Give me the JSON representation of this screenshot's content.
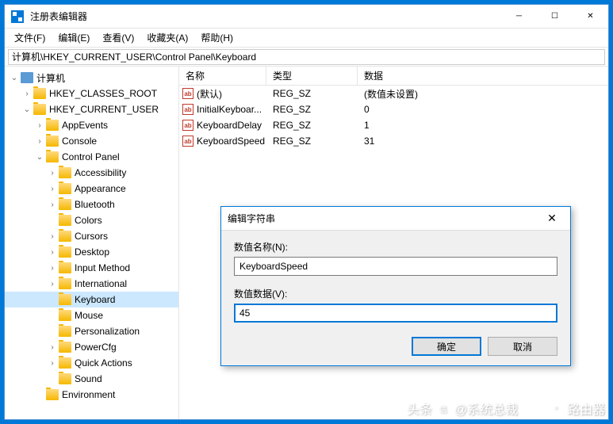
{
  "window": {
    "title": "注册表编辑器"
  },
  "menu": {
    "file": "文件(F)",
    "edit": "编辑(E)",
    "view": "查看(V)",
    "favorites": "收藏夹(A)",
    "help": "帮助(H)"
  },
  "address": "计算机\\HKEY_CURRENT_USER\\Control Panel\\Keyboard",
  "tree": {
    "root": "计算机",
    "hkcr": "HKEY_CLASSES_ROOT",
    "hkcu": "HKEY_CURRENT_USER",
    "appevents": "AppEvents",
    "console": "Console",
    "controlpanel": "Control Panel",
    "accessibility": "Accessibility",
    "appearance": "Appearance",
    "bluetooth": "Bluetooth",
    "colors": "Colors",
    "cursors": "Cursors",
    "desktop": "Desktop",
    "inputmethod": "Input Method",
    "international": "International",
    "keyboard": "Keyboard",
    "mouse": "Mouse",
    "personalization": "Personalization",
    "powercfg": "PowerCfg",
    "quickactions": "Quick Actions",
    "sound": "Sound",
    "environment": "Environment"
  },
  "columns": {
    "name": "名称",
    "type": "类型",
    "data": "数据"
  },
  "values": [
    {
      "name": "(默认)",
      "type": "REG_SZ",
      "data": "(数值未设置)"
    },
    {
      "name": "InitialKeyboar...",
      "type": "REG_SZ",
      "data": "0"
    },
    {
      "name": "KeyboardDelay",
      "type": "REG_SZ",
      "data": "1"
    },
    {
      "name": "KeyboardSpeed",
      "type": "REG_SZ",
      "data": "31"
    }
  ],
  "dialog": {
    "title": "编辑字符串",
    "name_label": "数值名称(N):",
    "name_value": "KeyboardSpeed",
    "data_label": "数值数据(V):",
    "data_value": "45",
    "ok": "确定",
    "cancel": "取消"
  },
  "watermark": {
    "prefix": "头条",
    "text": "@系统总裁",
    "router": "路由器"
  }
}
